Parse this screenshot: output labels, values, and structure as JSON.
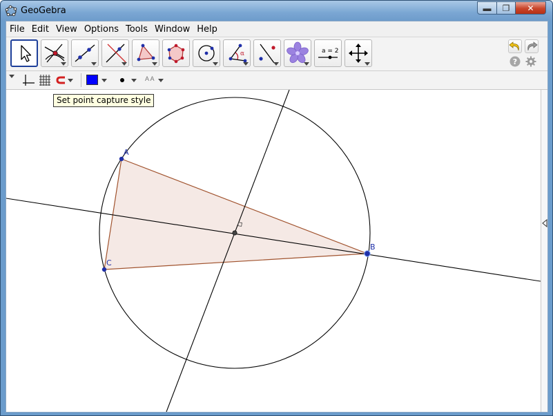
{
  "window": {
    "title": "GeoGebra",
    "controls": {
      "minimize": "▬",
      "maximize": "❐",
      "close": "✕"
    }
  },
  "menubar": {
    "items": [
      "File",
      "Edit",
      "View",
      "Options",
      "Tools",
      "Window",
      "Help"
    ]
  },
  "toolbar": {
    "tools": [
      {
        "name": "move-tool",
        "icon": "pointer-arrow-icon",
        "selected": true
      },
      {
        "name": "point-tool",
        "icon": "point-intersection-icon"
      },
      {
        "name": "line-tool",
        "icon": "line-through-points-icon"
      },
      {
        "name": "perpendicular-line-tool",
        "icon": "perpendicular-line-icon"
      },
      {
        "name": "polygon-tool",
        "icon": "polygon-icon"
      },
      {
        "name": "regular-polygon-tool",
        "icon": "regular-polygon-icon"
      },
      {
        "name": "circle-tool",
        "icon": "circle-center-point-icon"
      },
      {
        "name": "angle-tool",
        "icon": "angle-icon"
      },
      {
        "name": "reflect-tool",
        "icon": "reflect-line-icon"
      },
      {
        "name": "special-object-tool",
        "icon": "flower-icon"
      },
      {
        "name": "slider-tool",
        "icon": "slider-icon",
        "label": "a = 2"
      },
      {
        "name": "move-graphics-tool",
        "icon": "move-cross-arrows-icon"
      }
    ],
    "undo_icon": "undo-arrow-icon",
    "redo_icon": "redo-arrow-icon",
    "help_icon": "help-icon",
    "settings_icon": "gear-icon"
  },
  "stylebar": {
    "items": [
      "axes-toggle",
      "grid-toggle",
      "point-capture",
      "color",
      "point-style",
      "label-style"
    ],
    "color": "#0000ff",
    "label_style_text": "A A"
  },
  "tooltip": {
    "text": "Set point capture style"
  },
  "canvas": {
    "points": [
      {
        "label": "A"
      },
      {
        "label": "B"
      },
      {
        "label": "C"
      }
    ],
    "colors": {
      "triangle_fill": "#f3e5e0",
      "triangle_stroke": "#a0522d",
      "point": "#1f2fa8",
      "line": "#000000"
    }
  }
}
